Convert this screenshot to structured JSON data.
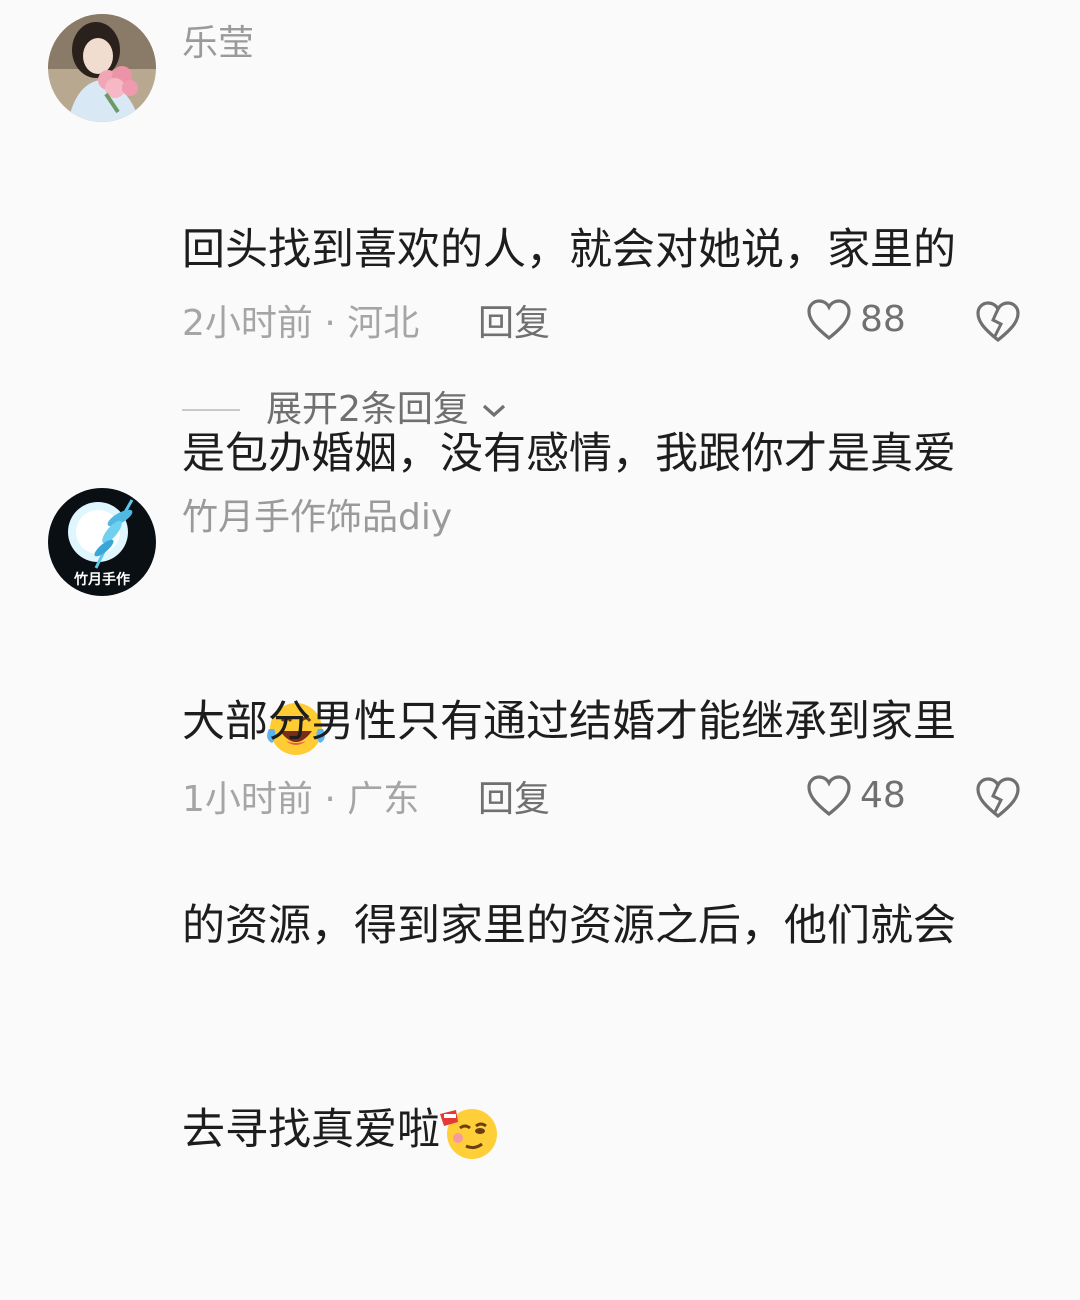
{
  "comments": [
    {
      "username": "乐莹",
      "avatar_icon": "avatar-girl-with-flowers",
      "lines": [
        "回头找到喜欢的人，就会对她说，家里的",
        "是包办婚姻，没有感情，我跟你才是真爱"
      ],
      "emoji": "laughing-tears-emoji",
      "time_location": "2小时前 · 河北",
      "reply_label": "回复",
      "likes": "88",
      "expand_label": "展开2条回复"
    },
    {
      "username": "竹月手作饰品diy",
      "avatar_text": "竹月手作",
      "lines": [
        "大部分男性只有通过结婚才能继承到家里",
        "的资源，得到家里的资源之后，他们就会",
        "去寻找真爱啦"
      ],
      "emoji": "tipsy-face-emoji",
      "time_location": "1小时前 · 广东",
      "reply_label": "回复",
      "likes": "48"
    }
  ],
  "colors": {
    "background": "#fafafa",
    "username": "#9a9a9a",
    "text": "#1d1d1d",
    "meta": "#a5a5a5",
    "action": "#707070"
  }
}
